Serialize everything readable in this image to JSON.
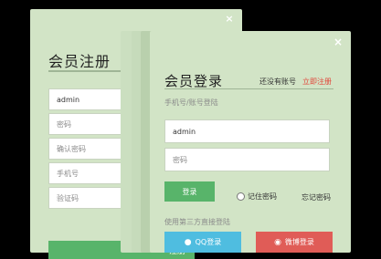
{
  "register": {
    "title": "会员注册",
    "close_glyph": "×",
    "fields": [
      {
        "value": "admin",
        "placeholder": ""
      },
      {
        "value": "",
        "placeholder": "密码"
      },
      {
        "value": "",
        "placeholder": "确认密码"
      },
      {
        "value": "",
        "placeholder": "手机号"
      },
      {
        "value": "",
        "placeholder": "验证码"
      }
    ],
    "submit_label": "注册"
  },
  "login": {
    "title": "会员登录",
    "close_glyph": "×",
    "no_account": "还没有账号",
    "register_link": "立即注册",
    "subtitle": "手机号/账号登陆",
    "username_value": "admin",
    "password_placeholder": "密码",
    "login_label": "登录",
    "remember_label": "记住密码",
    "forgot_label": "忘记密码",
    "third_party_label": "使用第三方直接登陆",
    "qq_label": "QQ登录",
    "weibo_label": "微博登录",
    "qq_icon": "qq-icon",
    "weibo_icon": "weibo-icon"
  },
  "colors": {
    "panel": "#d2e4c6",
    "primary": "#58b46a",
    "link": "#e2463a",
    "qq": "#4fbde0",
    "weibo": "#e05c57"
  }
}
